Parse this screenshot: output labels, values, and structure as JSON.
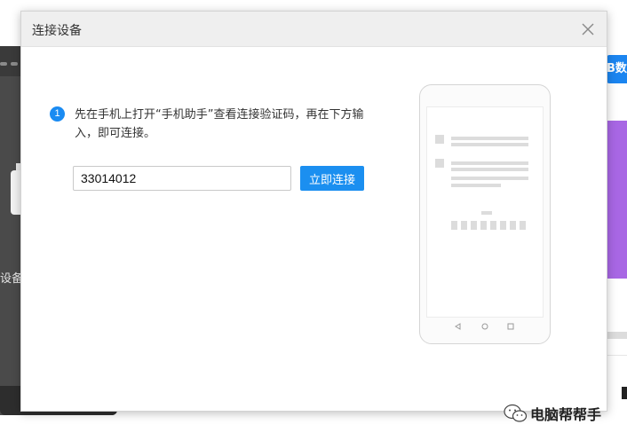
{
  "dialog": {
    "title": "连接设备",
    "step_number": "1",
    "instruction": "先在手机上打开“手机助手”查看连接验证码，再在下方输入，即可连接。",
    "code_input_value": "33014012",
    "connect_button_label": "立即连接"
  },
  "background": {
    "left_partial_text": "设备",
    "right_partial_button_text": "B数",
    "accent_color": "#1b8ff0",
    "purple_color": "#a867e4"
  },
  "watermark": {
    "text": "电脑帮帮手",
    "icon": "wechat-icon"
  },
  "icons": {
    "close": "close-icon",
    "phone_back": "back-triangle-icon",
    "phone_home": "home-circle-icon",
    "phone_recent": "recent-square-icon"
  }
}
